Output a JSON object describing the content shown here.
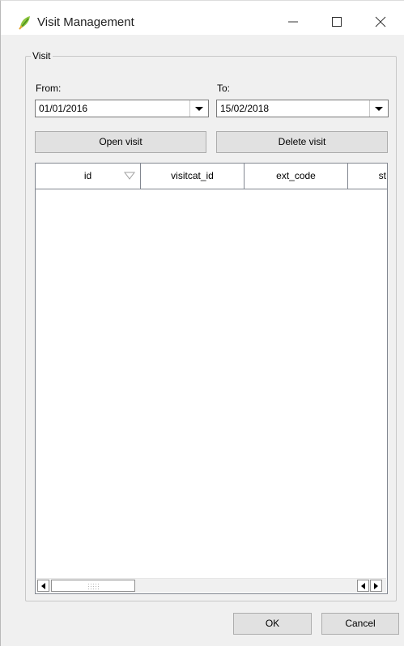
{
  "window": {
    "title": "Visit Management",
    "icon": "qgis-leaf-icon",
    "controls": [
      "minimize-icon",
      "maximize-icon",
      "close-icon"
    ]
  },
  "visit_group": {
    "title": "Visit",
    "from": {
      "label": "From:",
      "value": "01/01/2016"
    },
    "to": {
      "label": "To:",
      "value": "15/02/2018"
    },
    "open_button": "Open visit",
    "delete_button": "Delete visit"
  },
  "table": {
    "columns": [
      "id",
      "visitcat_id",
      "ext_code",
      "st"
    ],
    "rows": []
  },
  "footer": {
    "ok_label": "OK",
    "cancel_label": "Cancel"
  },
  "colors": {
    "background": "#f0f0f0",
    "titlebar": "#ffffff",
    "button_face": "#e1e1e1",
    "border": "#adadad"
  }
}
